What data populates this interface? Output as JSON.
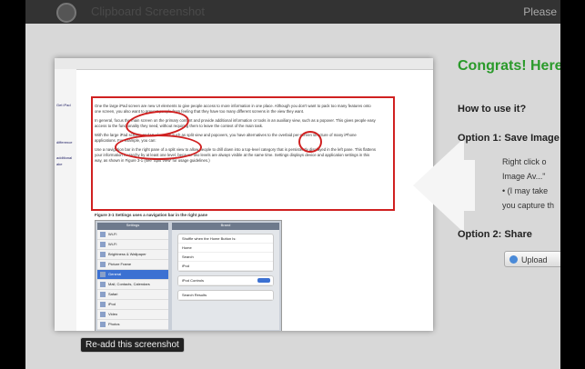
{
  "header": {
    "site_title": "Clipboard Screenshot",
    "right_text": "Please"
  },
  "preview": {
    "sidebar_items": [
      "Get iPad",
      "",
      "",
      "",
      "",
      "difference",
      "",
      "additional",
      "ake"
    ],
    "paragraphs": [
      "One the large iPad screen are new UI elements to give people access to more information in one place. Although you don't want to pack too many features onto one screen, you also want to prevent people from feeling that they have too many different screens in the view they want.",
      "In general, focus the main screen on the primary content and provide additional information or tools in an auxiliary view, such as a popover. This gives people easy access to the functionality they need, without requiring them to leave the context of the main task.",
      "With the large iPad screen, and UI elements such as split view and popovers, you have alternatives to the overlaid per-screen structure of many iPhone applications. For example, you can:",
      "Use a navigation bar in the right pane of a split view to allow people to drill down into a top-level category that is persistently displayed in the left pane. This flattens your information hierarchy by at least one level, because two levels are always visible at the same time. Settings displays device and application settings in this way, as shown in Figure 3-1 (see 'Split View' for usage guidelines.)"
    ],
    "figure_caption": "Figure 3-1  Settings uses a navigation bar in the right pane",
    "settings_left_title": "Settings",
    "settings_right_title": "Brand",
    "settings_items": [
      "Wi-Fi",
      "Wi-Fi",
      "Brightness & Wallpaper",
      "Picture Frame",
      "General",
      "Mail, Contacts, Calendars",
      "Safari",
      "iPod",
      "Video",
      "Photos"
    ],
    "settings_right_rows": [
      "Shuffle when the Home Button Is:",
      "Home",
      "Search",
      "iPod"
    ],
    "settings_right_rows2": [
      "iPod Controls",
      "Search Results"
    ]
  },
  "main": {
    "congrats_text": "Congrats! Here",
    "how_to_heading": "How to use it?",
    "option1_heading": "Option 1: Save Image",
    "option1_lines": [
      "Right click o",
      "Image Av...\"",
      "• (I may take",
      "you capture th"
    ],
    "option2_heading": "Option 2: Share",
    "upload_label": "Upload"
  },
  "footer": {
    "readd_label": "Re-add this screenshot"
  },
  "colors": {
    "accent_green": "#2a9a2a",
    "annotation_red": "#d02020",
    "selected_blue": "#3c71d2"
  },
  "icons": {
    "logo": "camera-lens-icon",
    "arrow": "left-arrow-icon",
    "upload": "upload-globe-icon"
  }
}
